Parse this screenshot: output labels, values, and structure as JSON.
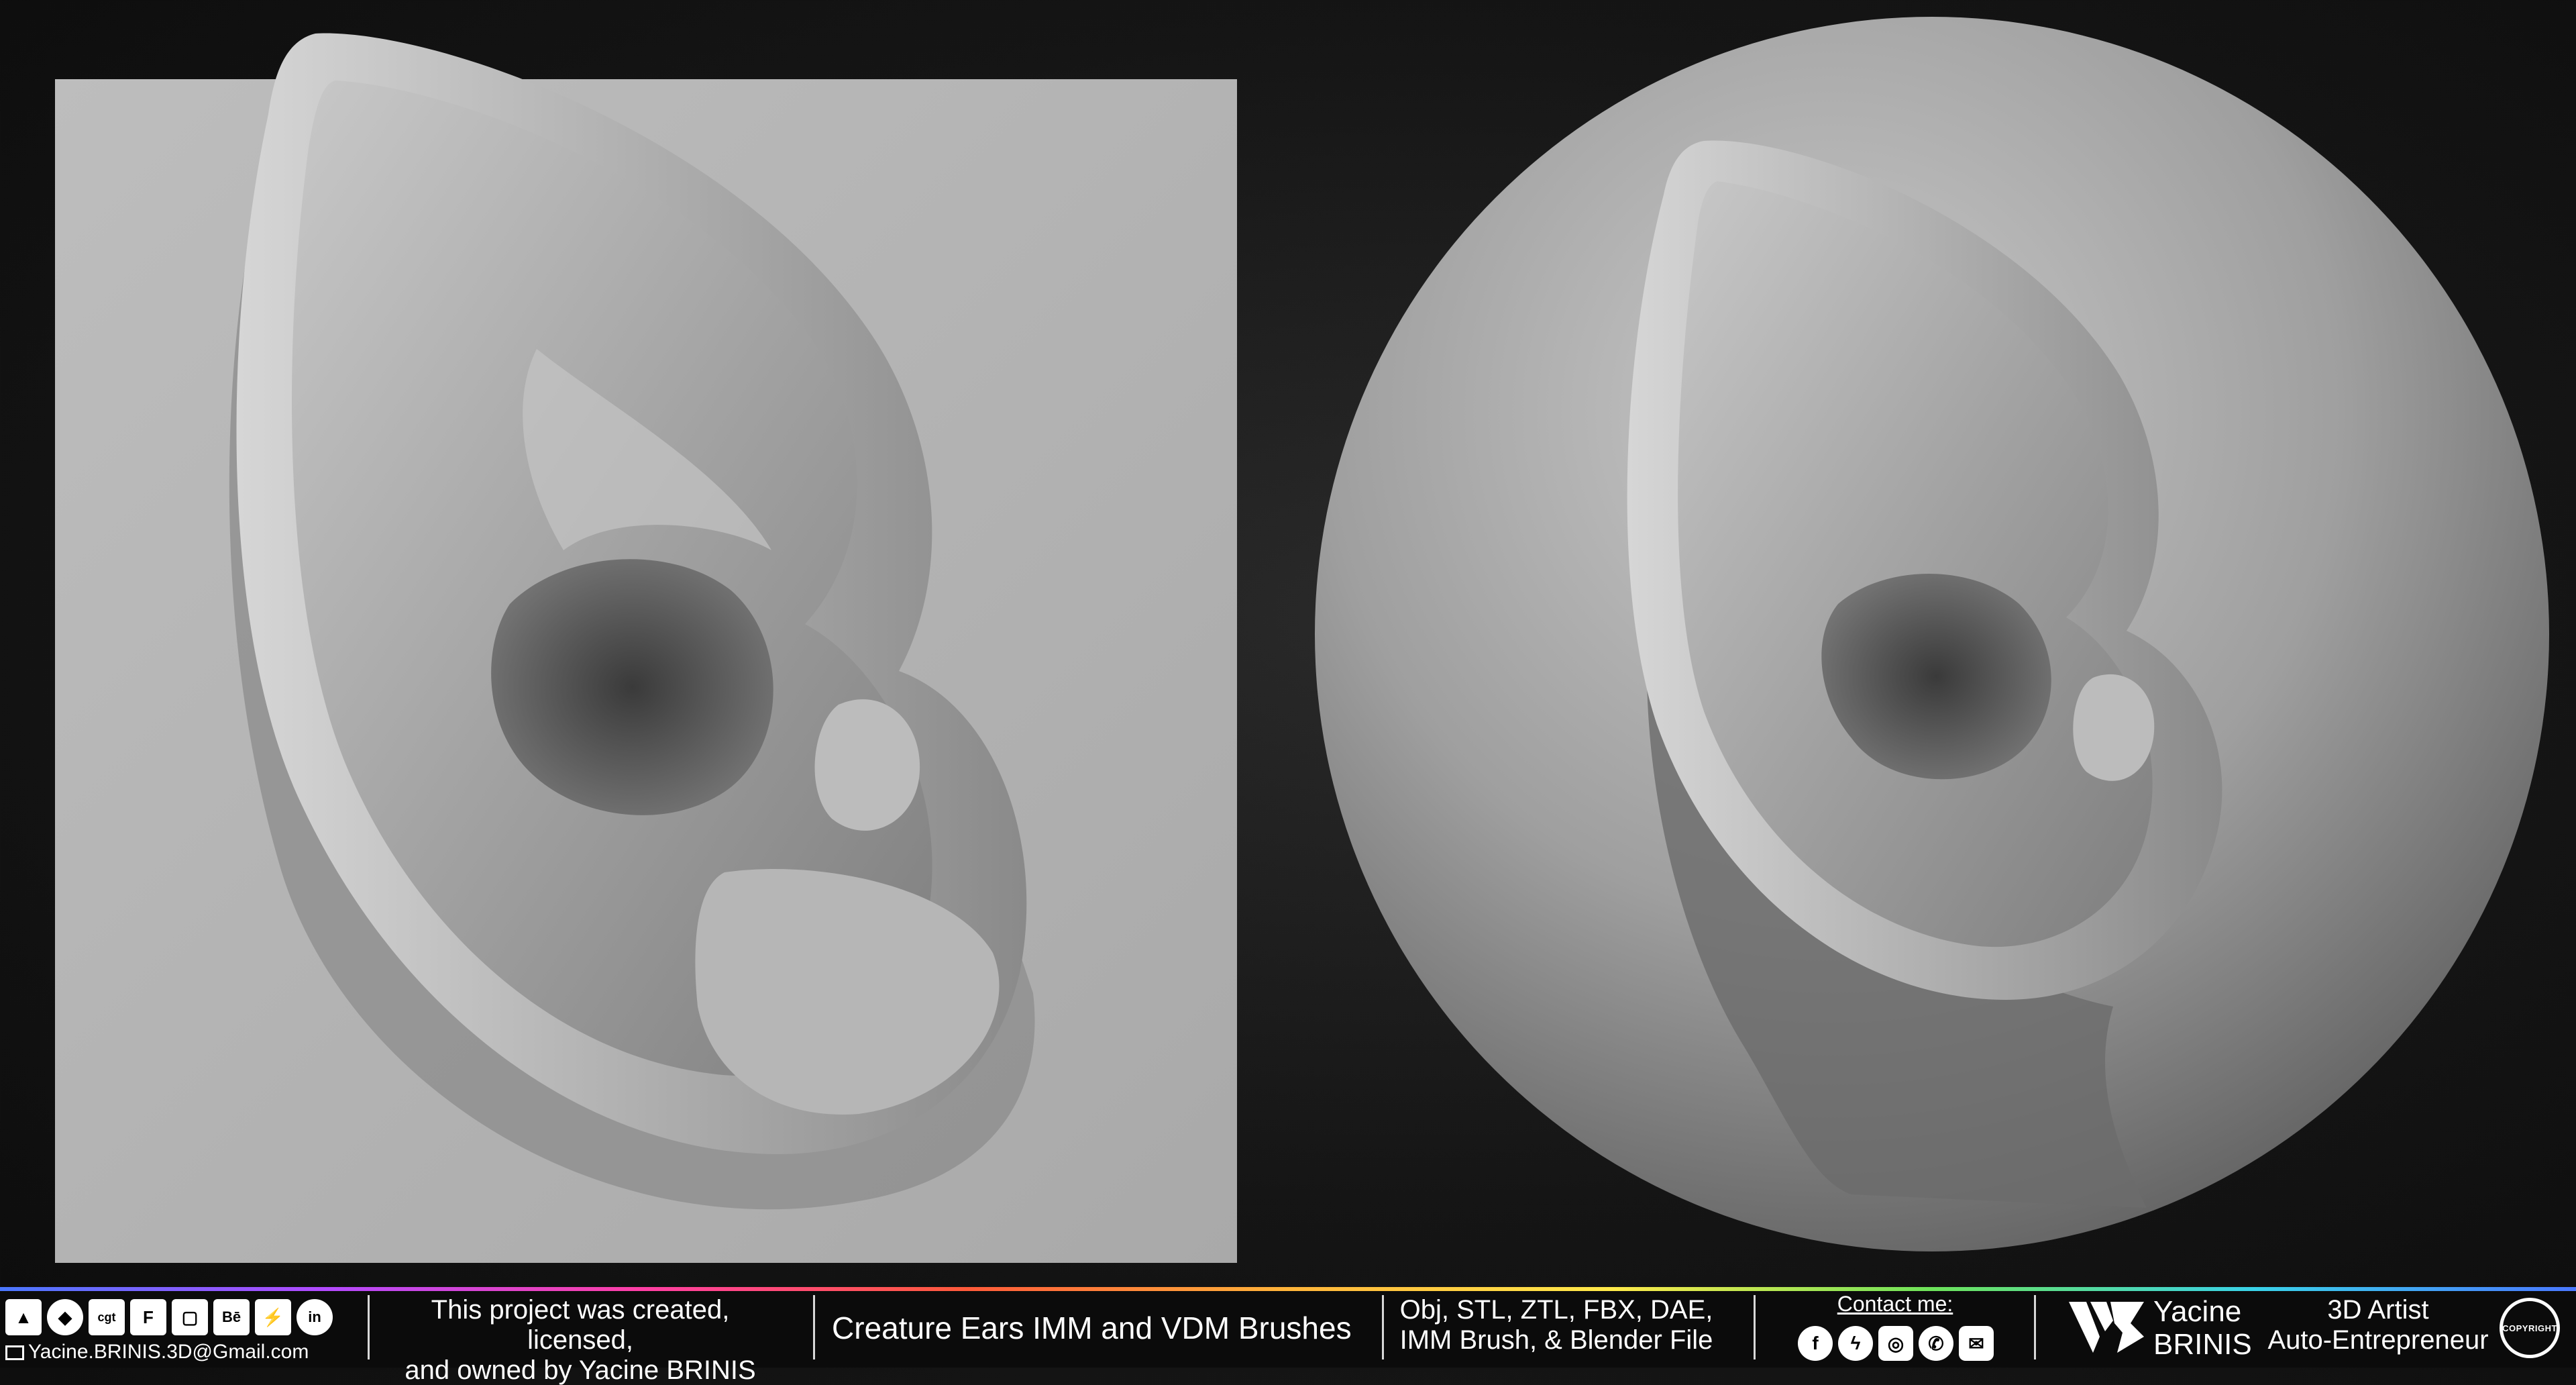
{
  "panels": {
    "left": {
      "subject": "ear-on-plane-render"
    },
    "right": {
      "subject": "ear-on-sphere-render"
    }
  },
  "footer": {
    "social_icons": [
      "artstation-icon",
      "sketchfab-icon",
      "cgtrader-icon",
      "fab-icon",
      "turbosquid-icon",
      "behance-icon",
      "blendermarket-icon",
      "linkedin-icon"
    ],
    "email": "Yacine.BRINIS.3D@Gmail.com",
    "ownership_line1": "This project was created, licensed,",
    "ownership_line2": "and owned by Yacine BRINIS",
    "product_title": "Creature Ears IMM and VDM Brushes",
    "formats_line1": "Obj, STL, ZTL, FBX, DAE,",
    "formats_line2": "IMM Brush, & Blender File",
    "contact_label": "Contact me:",
    "contact_icons": [
      "facebook-icon",
      "messenger-icon",
      "instagram-icon",
      "whatsapp-icon",
      "mail-icon"
    ],
    "author_first": "Yacine",
    "author_last": "BRINIS",
    "role_line1": "3D Artist",
    "role_line2": "Auto-Entrepreneur",
    "badge_text": "COPYRIGHT"
  },
  "colors": {
    "background": "#151515",
    "plane": "#b4b4b4",
    "clay": "#9a9a9a",
    "footer": "#0b0b0b",
    "text": "#ffffff"
  }
}
